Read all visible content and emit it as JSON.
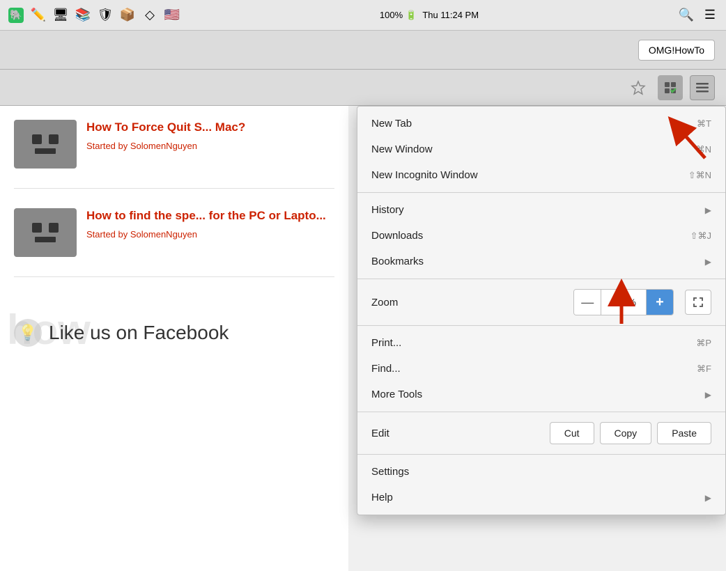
{
  "menubar": {
    "battery": "100%",
    "time": "Thu 11:24 PM",
    "icons": [
      "evernote",
      "pencil",
      "monitor",
      "book",
      "avast",
      "dropbox",
      "diamond",
      "flag"
    ]
  },
  "browser": {
    "omg_btn": "OMG!HowTo"
  },
  "toolbar": {
    "bookmark_icon": "☆",
    "extensions_icon": "✓",
    "menu_icon": "≡"
  },
  "page": {
    "article1": {
      "title": "How To Force Quit S... Mac?",
      "author_prefix": "Started by ",
      "author": "SolomenNguyen"
    },
    "article2": {
      "title": "How to find the spe... for the PC or Lapto...",
      "author_prefix": "Started by ",
      "author": "SolomenNguyen"
    },
    "footer": "Like us on Facebook"
  },
  "dropdown": {
    "sections": [
      {
        "items": [
          {
            "label": "New Tab",
            "shortcut": "⌘T",
            "hasArrow": false
          },
          {
            "label": "New Window",
            "shortcut": "⌘N",
            "hasArrow": false
          },
          {
            "label": "New Incognito Window",
            "shortcut": "⇧⌘N",
            "hasArrow": false
          }
        ]
      },
      {
        "items": [
          {
            "label": "History",
            "shortcut": "",
            "hasArrow": true
          },
          {
            "label": "Downloads",
            "shortcut": "⇧⌘J",
            "hasArrow": false
          },
          {
            "label": "Bookmarks",
            "shortcut": "",
            "hasArrow": true
          }
        ]
      },
      {
        "items": [
          {
            "label": "Zoom",
            "isZoom": true,
            "zoomMinus": "—",
            "zoomValue": "100%",
            "zoomPlus": "+",
            "hasFullscreen": true
          }
        ]
      },
      {
        "items": [
          {
            "label": "Print...",
            "shortcut": "⌘P",
            "hasArrow": false
          },
          {
            "label": "Find...",
            "shortcut": "⌘F",
            "hasArrow": false
          },
          {
            "label": "More Tools",
            "shortcut": "",
            "hasArrow": true
          }
        ]
      },
      {
        "items": [
          {
            "label": "Edit",
            "isEdit": true,
            "editBtns": [
              "Cut",
              "Copy",
              "Paste"
            ]
          }
        ]
      },
      {
        "items": [
          {
            "label": "Settings",
            "shortcut": "",
            "hasArrow": false
          },
          {
            "label": "Help",
            "shortcut": "",
            "hasArrow": true
          }
        ]
      }
    ]
  }
}
